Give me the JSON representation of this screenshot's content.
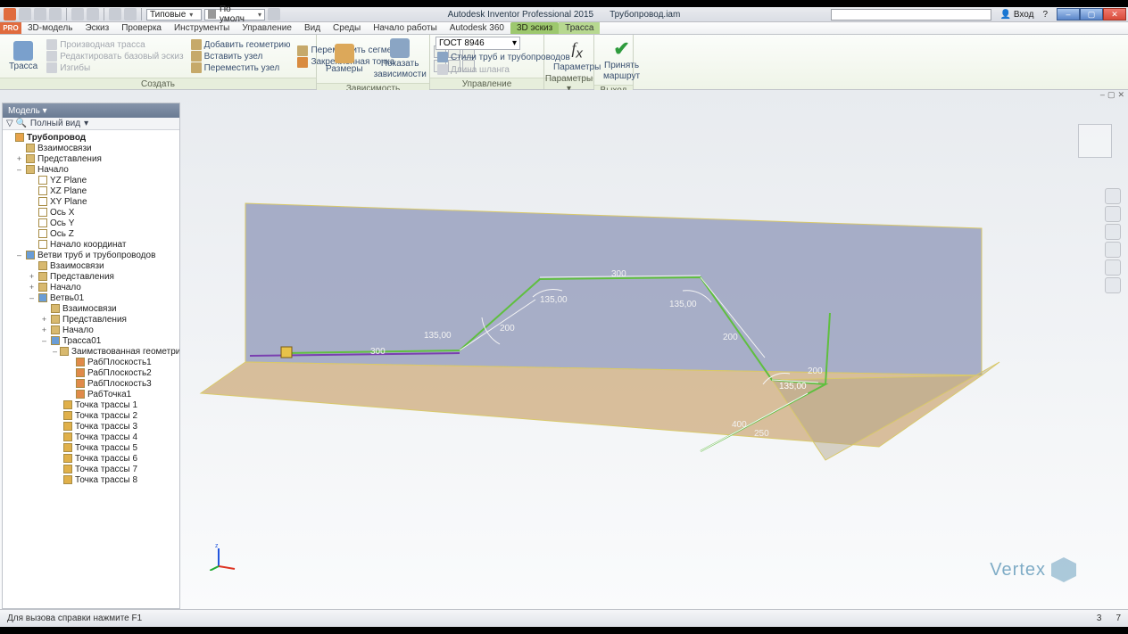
{
  "title": {
    "app": "Autodesk Inventor Professional 2015",
    "doc": "Трубопровод.iam"
  },
  "qat_dd1": "Типовые",
  "qat_dd2": "По умолч",
  "login": "Вход",
  "menutabs": [
    "3D-модель",
    "Эскиз",
    "Проверка",
    "Инструменты",
    "Управление",
    "Вид",
    "Среды",
    "Начало работы",
    "Autodesk 360",
    "3D эскиз",
    "Трасса"
  ],
  "ribbon": {
    "g1": {
      "title": "Создать",
      "big": "Трасса",
      "cmds_a": [
        "Производная трасса",
        "Редактировать базовый эскиз",
        "Изгибы"
      ],
      "cmds_b": [
        "Добавить геометрию",
        "Вставить узел",
        "Переместить узел"
      ],
      "cmds_c": [
        "Переместить сегмент",
        "Закрепленная точка"
      ]
    },
    "g2": {
      "title": "Зависимость",
      "big1": "Размеры",
      "big2a": "Показать",
      "big2b": "зависимости"
    },
    "g3": {
      "title": "Управление",
      "std": "ГОСТ 8946",
      "cmd1": "Стили труб и трубопроводов",
      "cmd2": "Длина шланга"
    },
    "g4": {
      "title": "Параметры ▾",
      "big": "Параметры"
    },
    "g5": {
      "title": "Выход",
      "big1": "Принять",
      "big2": "маршрут"
    }
  },
  "browser": {
    "hdr": "Модель ▾",
    "filter": "Полный вид",
    "root": "Трубопровод",
    "n1": "Взаимосвязи",
    "n2": "Представления",
    "n3": "Начало",
    "n3a": "YZ Plane",
    "n3b": "XZ Plane",
    "n3c": "XY Plane",
    "n3d": "Ось X",
    "n3e": "Ось Y",
    "n3f": "Ось Z",
    "n3g": "Начало координат",
    "n4": "Ветви труб и трубопроводов",
    "n4a": "Взаимосвязи",
    "n4b": "Представления",
    "n4c": "Начало",
    "n4d": "Ветвь01",
    "n4d1": "Взаимосвязи",
    "n4d2": "Представления",
    "n4d3": "Начало",
    "n4d4": "Трасса01",
    "n4d4a": "Заимствованная геометрия",
    "wp1": "РабПлоскость1",
    "wp2": "РабПлоскость2",
    "wp3": "РабПлоскость3",
    "wp4": "РабТочка1",
    "tp1": "Точка трассы 1",
    "tp2": "Точка трассы 2",
    "tp3": "Точка трассы 3",
    "tp4": "Точка трассы 4",
    "tp5": "Точка трассы 5",
    "tp6": "Точка трассы 6",
    "tp7": "Точка трассы 7",
    "tp8": "Точка трассы 8"
  },
  "dims": {
    "d300a": "300",
    "d300b": "300",
    "d200a": "200",
    "d200b": "200",
    "d200c": "200",
    "d250": "250",
    "d400": "400",
    "a1": "135,00",
    "a2": "135,00",
    "a3": "135,00",
    "a4": "135,00"
  },
  "status": {
    "hint": "Для вызова справки нажмите F1",
    "r1": "3",
    "r2": "7"
  },
  "logo": "Vertex"
}
